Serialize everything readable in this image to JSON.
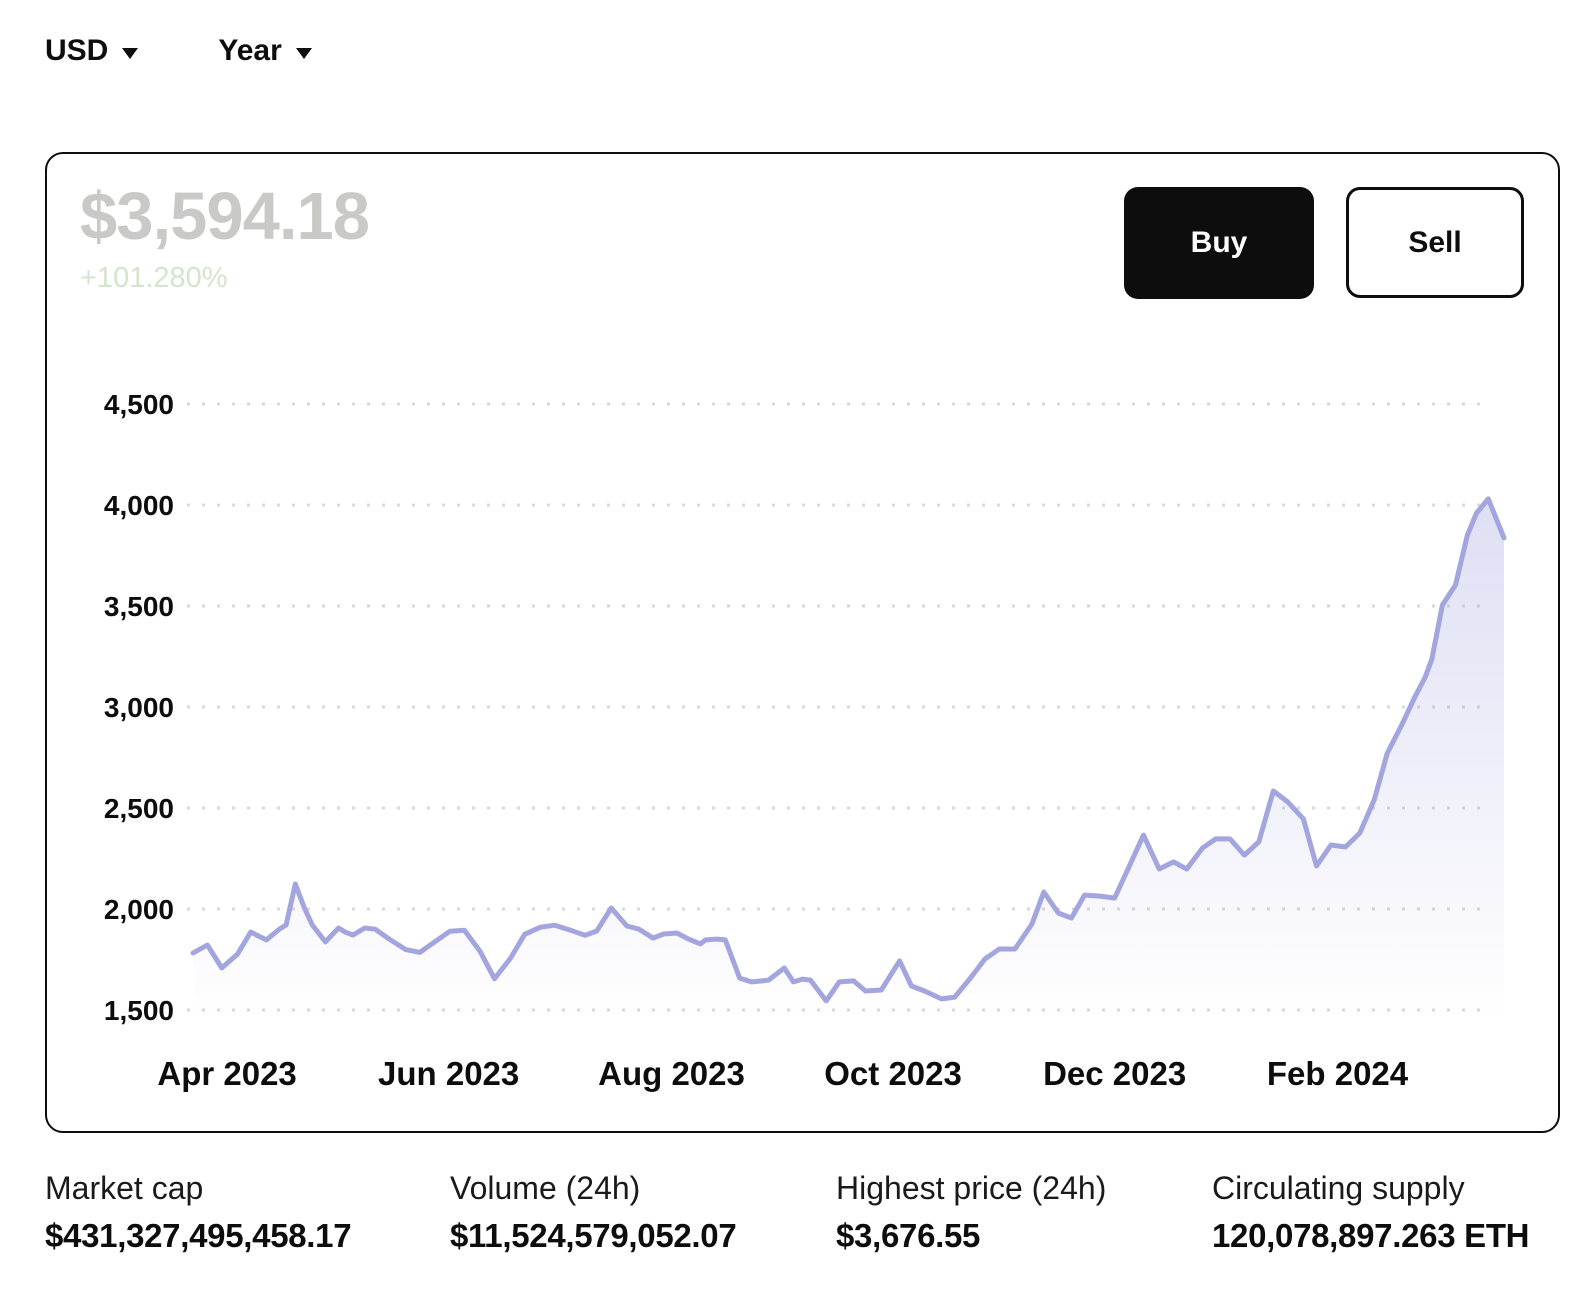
{
  "toolbar": {
    "currency": "USD",
    "range": "Year"
  },
  "card": {
    "price": "$3,594.18",
    "change": "+101.280%",
    "buy_label": "Buy",
    "sell_label": "Sell"
  },
  "chart_data": {
    "type": "area",
    "ylim": [
      1500,
      4500
    ],
    "y_ticks": [
      4500,
      4000,
      3500,
      3000,
      2500,
      2000,
      1500
    ],
    "x_ticks": [
      {
        "label": "Apr 2023",
        "frac": 0.026
      },
      {
        "label": "Jun 2023",
        "frac": 0.195
      },
      {
        "label": "Aug 2023",
        "frac": 0.365
      },
      {
        "label": "Oct 2023",
        "frac": 0.534
      },
      {
        "label": "Dec 2023",
        "frac": 0.703
      },
      {
        "label": "Feb 2024",
        "frac": 0.873
      }
    ],
    "grid": "dotted",
    "legend": "none",
    "line_color": "#a3a5df",
    "fill_color": "#a3a5df",
    "grid_color": "#d8d8d8",
    "points": [
      [
        0.0,
        1782
      ],
      [
        0.011,
        1822
      ],
      [
        0.022,
        1708
      ],
      [
        0.034,
        1777
      ],
      [
        0.044,
        1886
      ],
      [
        0.05,
        1866
      ],
      [
        0.056,
        1847
      ],
      [
        0.066,
        1901
      ],
      [
        0.071,
        1921
      ],
      [
        0.078,
        2124
      ],
      [
        0.085,
        2005
      ],
      [
        0.091,
        1921
      ],
      [
        0.101,
        1837
      ],
      [
        0.111,
        1906
      ],
      [
        0.116,
        1886
      ],
      [
        0.122,
        1871
      ],
      [
        0.131,
        1906
      ],
      [
        0.139,
        1900
      ],
      [
        0.15,
        1850
      ],
      [
        0.162,
        1800
      ],
      [
        0.173,
        1785
      ],
      [
        0.185,
        1840
      ],
      [
        0.196,
        1890
      ],
      [
        0.207,
        1895
      ],
      [
        0.219,
        1790
      ],
      [
        0.23,
        1655
      ],
      [
        0.242,
        1755
      ],
      [
        0.253,
        1875
      ],
      [
        0.265,
        1910
      ],
      [
        0.276,
        1920
      ],
      [
        0.288,
        1895
      ],
      [
        0.299,
        1870
      ],
      [
        0.308,
        1891
      ],
      [
        0.319,
        2005
      ],
      [
        0.331,
        1916
      ],
      [
        0.34,
        1901
      ],
      [
        0.351,
        1856
      ],
      [
        0.359,
        1876
      ],
      [
        0.369,
        1881
      ],
      [
        0.378,
        1851
      ],
      [
        0.387,
        1827
      ],
      [
        0.391,
        1847
      ],
      [
        0.4,
        1851
      ],
      [
        0.406,
        1847
      ],
      [
        0.417,
        1658
      ],
      [
        0.426,
        1639
      ],
      [
        0.434,
        1644
      ],
      [
        0.439,
        1648
      ],
      [
        0.451,
        1708
      ],
      [
        0.458,
        1639
      ],
      [
        0.465,
        1653
      ],
      [
        0.471,
        1648
      ],
      [
        0.483,
        1545
      ],
      [
        0.493,
        1639
      ],
      [
        0.504,
        1644
      ],
      [
        0.513,
        1594
      ],
      [
        0.525,
        1599
      ],
      [
        0.539,
        1743
      ],
      [
        0.548,
        1619
      ],
      [
        0.558,
        1594
      ],
      [
        0.571,
        1555
      ],
      [
        0.581,
        1564
      ],
      [
        0.593,
        1658
      ],
      [
        0.604,
        1752
      ],
      [
        0.615,
        1802
      ],
      [
        0.627,
        1802
      ],
      [
        0.64,
        1926
      ],
      [
        0.649,
        2084
      ],
      [
        0.66,
        1980
      ],
      [
        0.67,
        1955
      ],
      [
        0.68,
        2069
      ],
      [
        0.692,
        2064
      ],
      [
        0.703,
        2054
      ],
      [
        0.714,
        2210
      ],
      [
        0.725,
        2366
      ],
      [
        0.737,
        2198
      ],
      [
        0.748,
        2233
      ],
      [
        0.758,
        2198
      ],
      [
        0.77,
        2302
      ],
      [
        0.78,
        2347
      ],
      [
        0.791,
        2347
      ],
      [
        0.802,
        2267
      ],
      [
        0.813,
        2332
      ],
      [
        0.824,
        2584
      ],
      [
        0.835,
        2530
      ],
      [
        0.847,
        2446
      ],
      [
        0.857,
        2213
      ],
      [
        0.868,
        2317
      ],
      [
        0.879,
        2307
      ],
      [
        0.89,
        2376
      ],
      [
        0.901,
        2540
      ],
      [
        0.911,
        2772
      ],
      [
        0.922,
        2911
      ],
      [
        0.932,
        3050
      ],
      [
        0.94,
        3149
      ],
      [
        0.945,
        3238
      ],
      [
        0.953,
        3505
      ],
      [
        0.963,
        3604
      ],
      [
        0.972,
        3850
      ],
      [
        0.979,
        3960
      ],
      [
        0.988,
        4030
      ],
      [
        1.0,
        3837
      ]
    ]
  },
  "stats": [
    {
      "label": "Market cap",
      "value": "$431,327,495,458.17"
    },
    {
      "label": "Volume (24h)",
      "value": "$11,524,579,052.07"
    },
    {
      "label": "Highest price (24h)",
      "value": "$3,676.55"
    },
    {
      "label": "Circulating supply",
      "value": "120,078,897.263 ETH"
    }
  ]
}
